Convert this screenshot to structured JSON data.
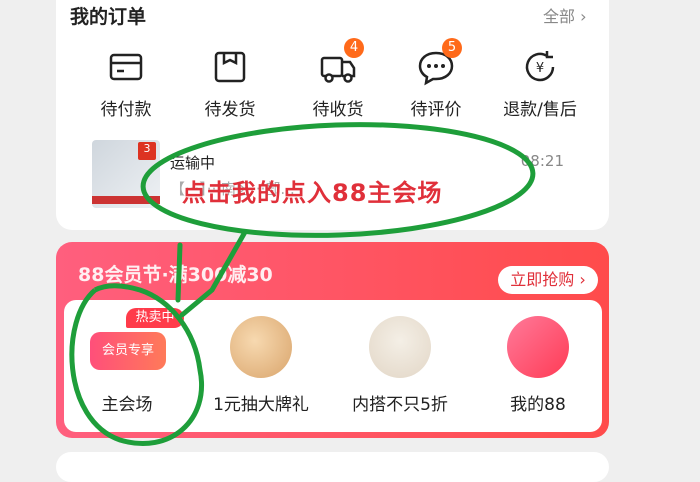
{
  "orders": {
    "title": "我的订单",
    "all": "全部",
    "items": [
      {
        "label": "待付款",
        "icon": "wallet-icon",
        "badge": ""
      },
      {
        "label": "待发货",
        "icon": "box-icon",
        "badge": ""
      },
      {
        "label": "待收货",
        "icon": "truck-icon",
        "badge": "4"
      },
      {
        "label": "待评价",
        "icon": "chat-icon",
        "badge": "5"
      },
      {
        "label": "退款/售后",
        "icon": "refund-icon",
        "badge": ""
      }
    ]
  },
  "shipping": {
    "badge": "3",
    "status": "运输中",
    "time": "08:21",
    "address": "【···】···南区···部..."
  },
  "annotation": "点击我的点入88主会场",
  "promo": {
    "headline": "88会员节·满300减30",
    "grab_label": "立即抢购",
    "items": [
      {
        "label": "主会场",
        "hot": "热卖中",
        "member": "会员专享"
      },
      {
        "label": "1元抽大牌礼"
      },
      {
        "label": "内搭不只5折"
      },
      {
        "label": "我的88"
      }
    ]
  },
  "colors": {
    "accent": "#e0303a",
    "badge": "#ff6a1a",
    "circle": "#1e9e3a"
  }
}
